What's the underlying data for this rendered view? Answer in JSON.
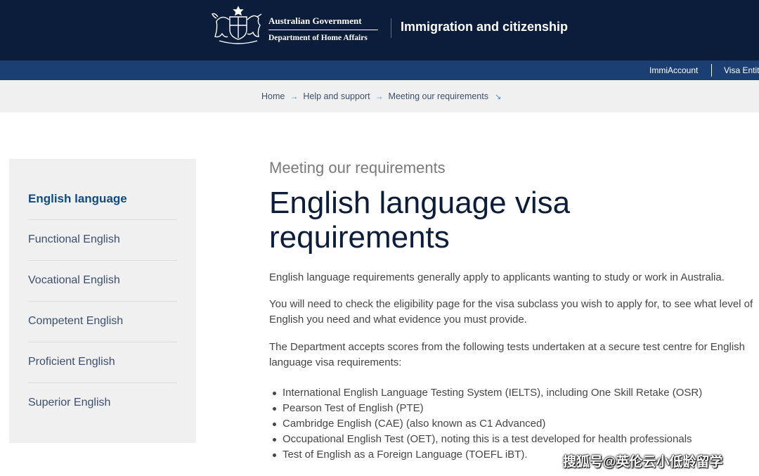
{
  "header": {
    "gov_line1": "Australian Government",
    "gov_line2": "Department of Home Affairs",
    "site_title": "Immigration and citizenship",
    "crest_icon": "coat-of-arms-icon",
    "bg_color": "#0b1d3a"
  },
  "nav": {
    "items": [
      "ImmiAccount",
      "Visa Entit"
    ],
    "bg_color": "#1c3f73"
  },
  "breadcrumb": {
    "items": [
      "Home",
      "Help and support",
      "Meeting our requirements"
    ],
    "arrow_icon": "arrow-right-icon",
    "end_icon": "arrow-down-right-icon"
  },
  "sidebar": {
    "items": [
      {
        "label": "English language",
        "active": true
      },
      {
        "label": "Functional English",
        "active": false
      },
      {
        "label": "Vocational English",
        "active": false
      },
      {
        "label": "Competent English",
        "active": false
      },
      {
        "label": "Proficient English",
        "active": false
      },
      {
        "label": "Superior English",
        "active": false
      }
    ]
  },
  "main": {
    "kicker": "Meeting our requirements",
    "title": "English language visa requirements",
    "paragraphs": [
      "English language requirements generally apply to applicants wanting to study or work in Australia.",
      "You will need to check the eligibility page for the visa subclass you wish to apply for, to see what level of English you need and what evidence you must provide.",
      "The Department accepts scores from the following tests undertaken at a secure test centre for English language visa requirements:"
    ],
    "tests": [
      "International English Language Testing System (IELTS), including One Skill Retake (OSR)",
      "Pearson Test of English (PTE)",
      "Cambridge English (CAE) (also known as C1 Advanced)",
      "Occupational English Test (OET), noting this is a test developed for health professionals",
      "Test of English as a Foreign Language (TOEFL iBT)."
    ]
  },
  "watermark": "搜狐号@英伦云小低龄留学"
}
